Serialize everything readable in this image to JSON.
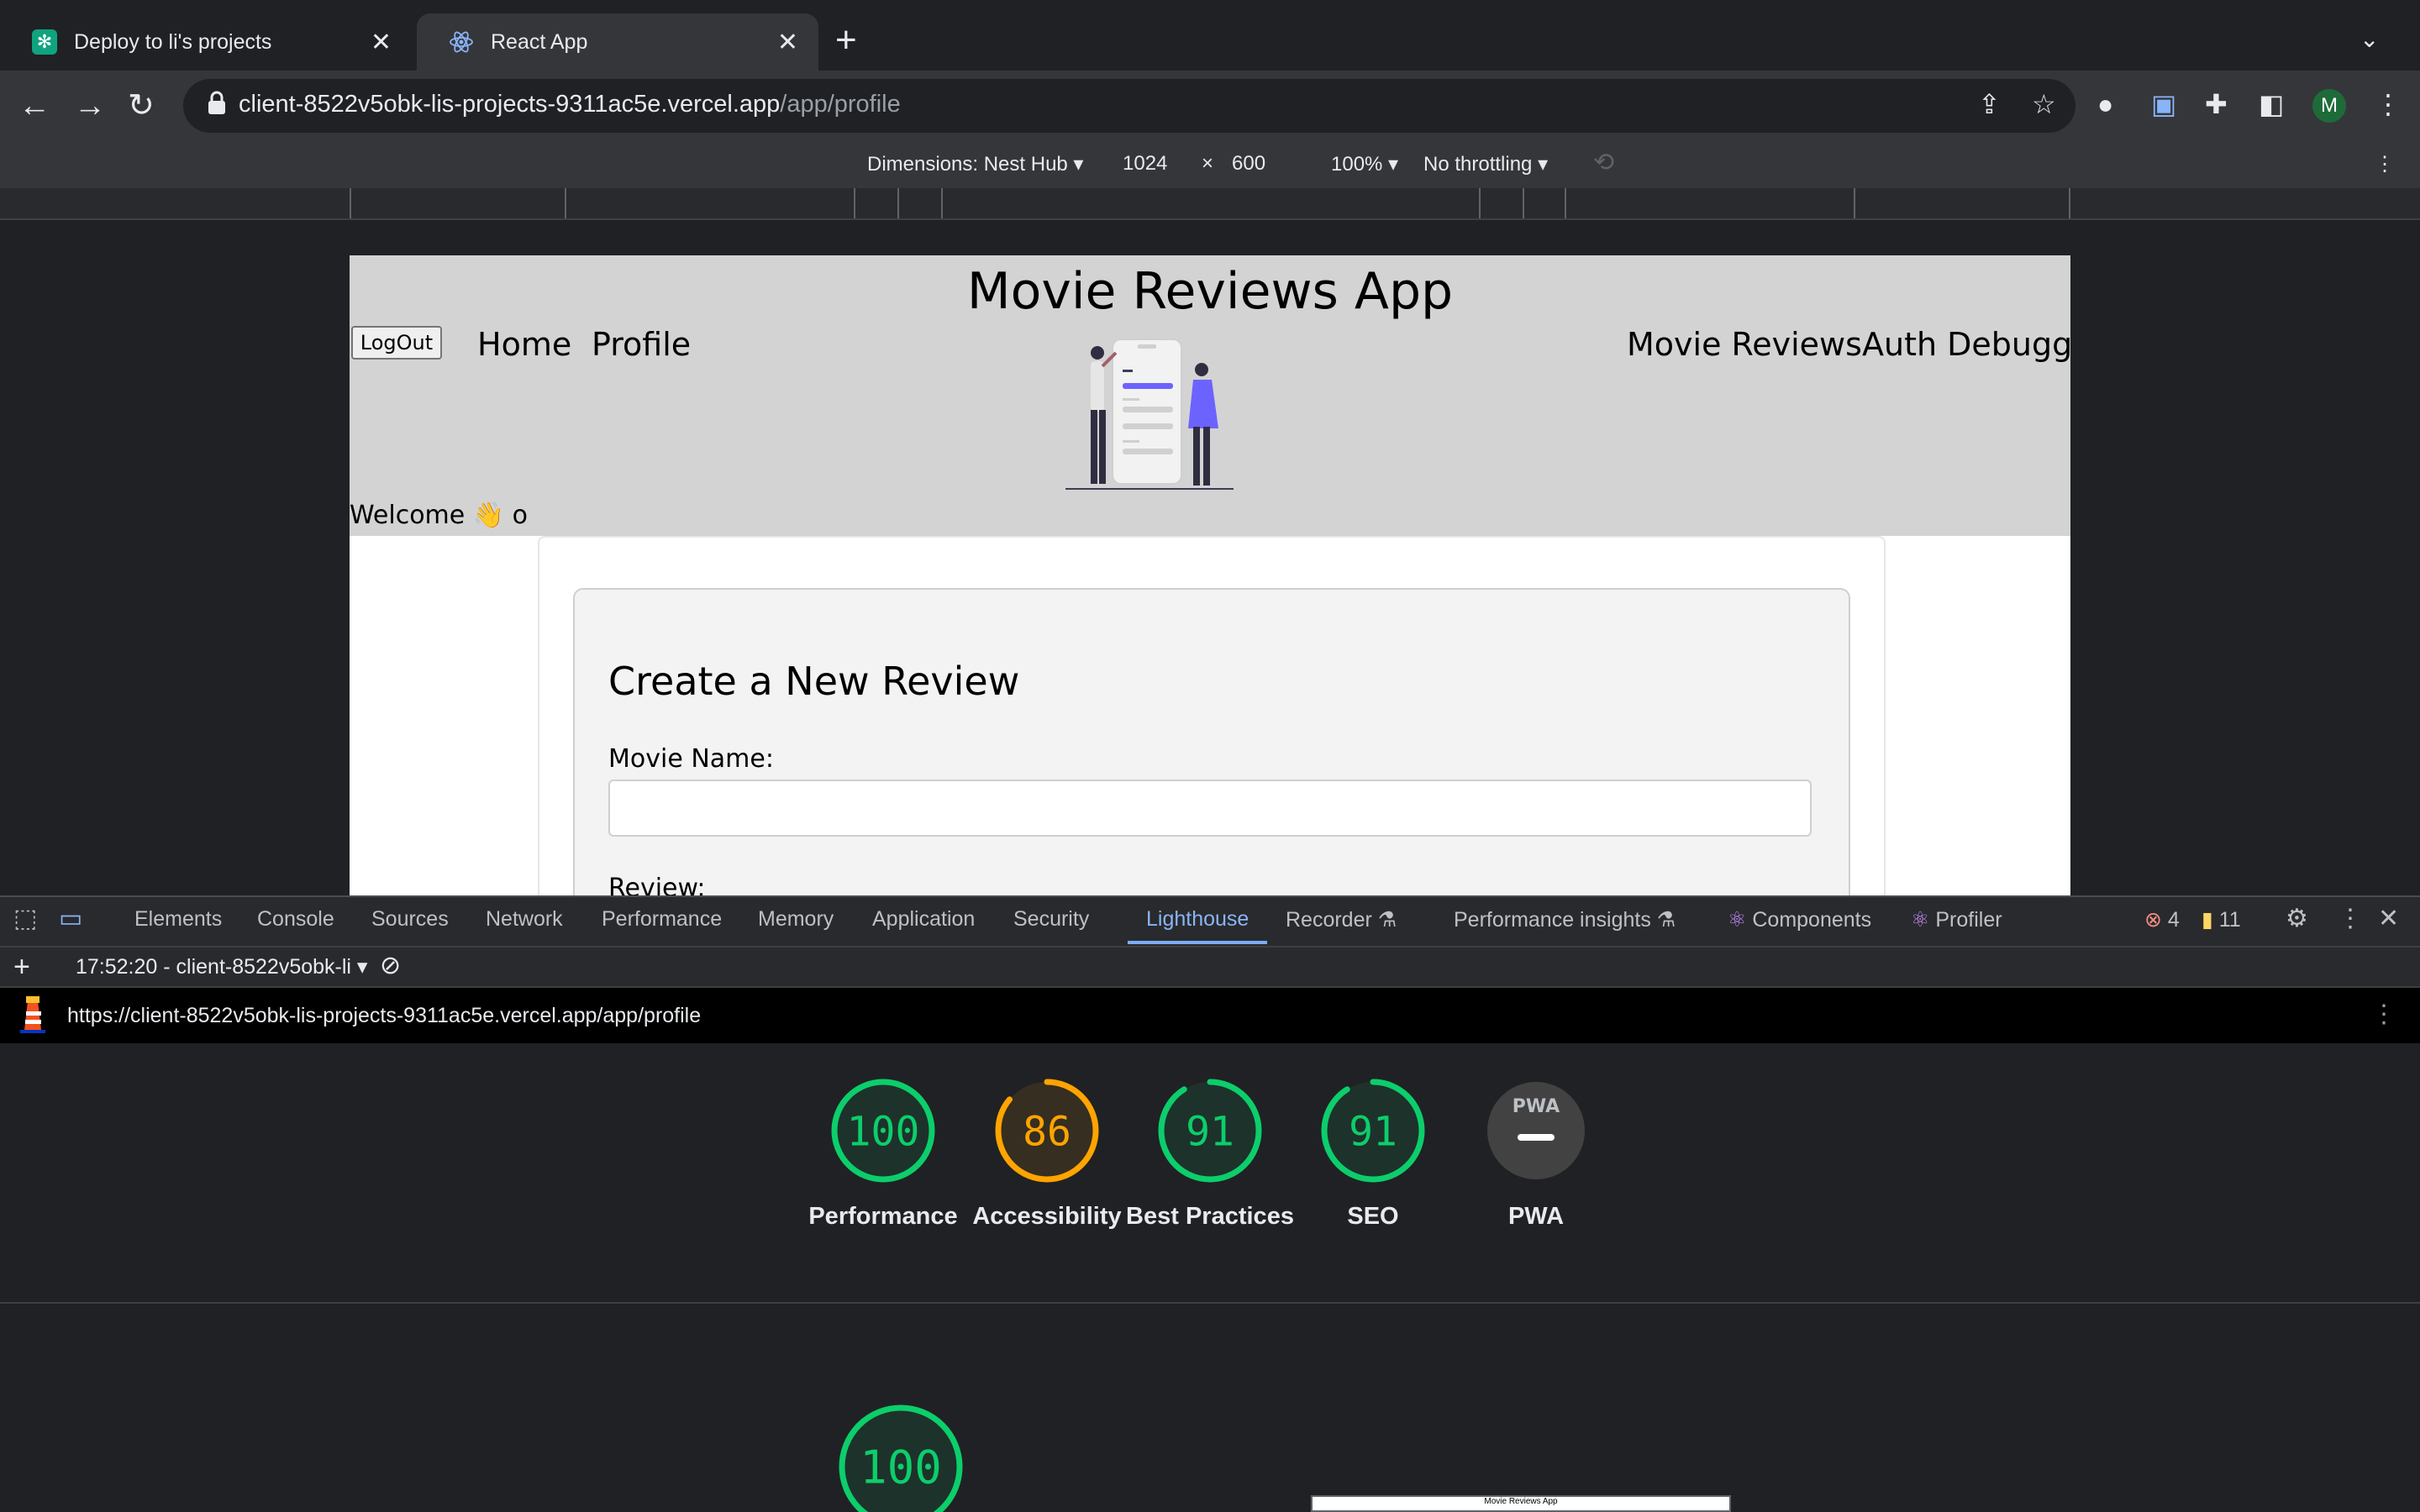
{
  "browser": {
    "tabs": [
      {
        "title": "Deploy to li's projects",
        "icon": "openai-icon"
      },
      {
        "title": "React App",
        "icon": "react-icon",
        "active": true
      }
    ],
    "url_host": "client-8522v5obk-lis-projects-9311ac5e.vercel.app",
    "url_path": "/app/profile",
    "profile_initial": "M"
  },
  "device_toolbar": {
    "dimensions": "Dimensions: Nest Hub",
    "width": "1024",
    "times": "×",
    "height": "600",
    "zoom": "100%",
    "throttling": "No throttling"
  },
  "app": {
    "title": "Movie Reviews App",
    "logout_label": "LogOut",
    "nav_left": [
      "Home",
      "Profile"
    ],
    "nav_right": [
      "Movie Reviews",
      "Auth Debugger"
    ],
    "welcome": "Welcome 👋 o",
    "form": {
      "title": "Create a New Review",
      "movie_label": "Movie Name:",
      "movie_value": "",
      "review_label": "Review:"
    }
  },
  "devtools": {
    "tabs": [
      "Elements",
      "Console",
      "Sources",
      "Network",
      "Performance",
      "Memory",
      "Application",
      "Security",
      "Lighthouse",
      "Recorder",
      "Performance insights",
      "Components",
      "Profiler"
    ],
    "active_tab": "Lighthouse",
    "errors": "4",
    "warnings": "11",
    "report_selector": "17:52:20 - client-8522v5obk-li",
    "report_url": "https://client-8522v5obk-lis-projects-9311ac5e.vercel.app/app/profile"
  },
  "lighthouse": {
    "scores": [
      {
        "label": "Performance",
        "value": 100,
        "display": "100",
        "color": "#0cce6b"
      },
      {
        "label": "Accessibility",
        "value": 86,
        "display": "86",
        "color": "#ffa400"
      },
      {
        "label": "Best Practices",
        "value": 91,
        "display": "91",
        "color": "#0cce6b"
      },
      {
        "label": "SEO",
        "value": 91,
        "display": "91",
        "color": "#0cce6b"
      },
      {
        "label": "PWA",
        "value": null,
        "display": "",
        "badge": "PWA",
        "color": "#5f6368"
      }
    ],
    "detail_score": {
      "value": 100,
      "display": "100",
      "color": "#0cce6b"
    },
    "thumbnail_title": "Movie Reviews App"
  }
}
